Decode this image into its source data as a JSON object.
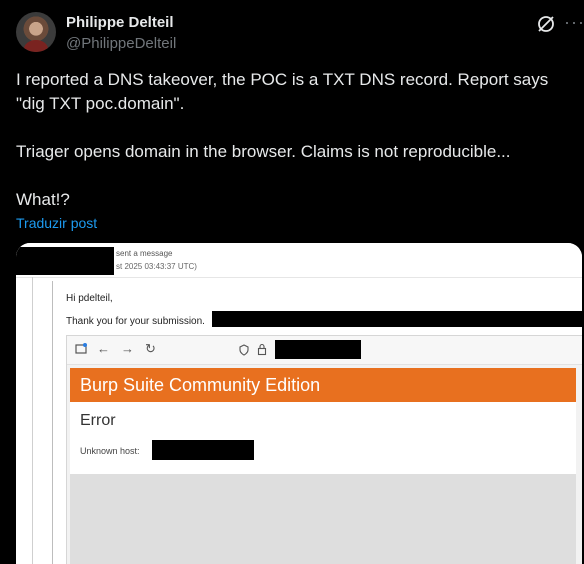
{
  "author": {
    "name": "Philippe Delteil",
    "handle": "@PhilippeDelteil",
    "avatar_icon": "avatar-photo"
  },
  "header_actions": {
    "grok_icon": "grok-icon",
    "more_label": "···"
  },
  "tweet": {
    "text": "I reported a DNS takeover, the POC is a TXT DNS record. Report says \"dig TXT poc.domain\".\n\nTriager opens domain in the browser. Claims is not reproducible...\n\nWhat!?",
    "translate_label": "Traduzir post"
  },
  "media": {
    "email": {
      "sender_suffix": "sent a message",
      "date_fragment": "st 2025 03:43:37 UTC)",
      "greeting": "Hi pdelteil,",
      "thanks": "Thank you for your submission."
    },
    "browser": {
      "back_icon": "←",
      "forward_icon": "→",
      "reload_icon": "↻",
      "banner_title": "Burp Suite Community Edition",
      "error_title": "Error",
      "unknown_host_label": "Unknown host:"
    },
    "colors": {
      "burp_orange": "#e8701f",
      "link_blue": "#1d9bf0"
    }
  }
}
